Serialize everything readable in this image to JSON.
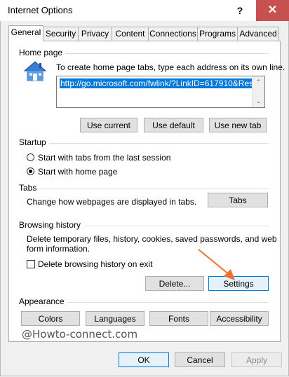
{
  "window": {
    "title": "Internet Options",
    "help": "?",
    "close": "✕"
  },
  "tabs": [
    "General",
    "Security",
    "Privacy",
    "Content",
    "Connections",
    "Programs",
    "Advanced"
  ],
  "home_page": {
    "label": "Home page",
    "instruction": "To create home page tabs, type each address on its own line.",
    "url": "http://go.microsoft.com/fwlink/?LinkID=617910&Res",
    "buttons": {
      "use_current": "Use current",
      "use_default": "Use default",
      "use_new_tab": "Use new tab"
    }
  },
  "startup": {
    "label": "Startup",
    "option_last_session": "Start with tabs from the last session",
    "option_home_page": "Start with home page",
    "selected": "Start with home page"
  },
  "tabs_group": {
    "label": "Tabs",
    "description": "Change how webpages are displayed in tabs.",
    "button": "Tabs"
  },
  "browsing_history": {
    "label": "Browsing history",
    "description_line1": "Delete temporary files, history, cookies, saved passwords, and web",
    "description_line2": "form information.",
    "checkbox_label": "Delete browsing history on exit",
    "checkbox_checked": false,
    "delete_button": "Delete...",
    "settings_button": "Settings"
  },
  "appearance": {
    "label": "Appearance",
    "colors": "Colors",
    "languages": "Languages",
    "fonts": "Fonts",
    "accessibility": "Accessibility"
  },
  "watermark": "@Howto-connect.com",
  "dialog_buttons": {
    "ok": "OK",
    "cancel": "Cancel",
    "apply": "Apply"
  },
  "colors": {
    "accent": "#0078d7",
    "close_button": "#c75050",
    "annotation_arrow": "#f07030"
  }
}
